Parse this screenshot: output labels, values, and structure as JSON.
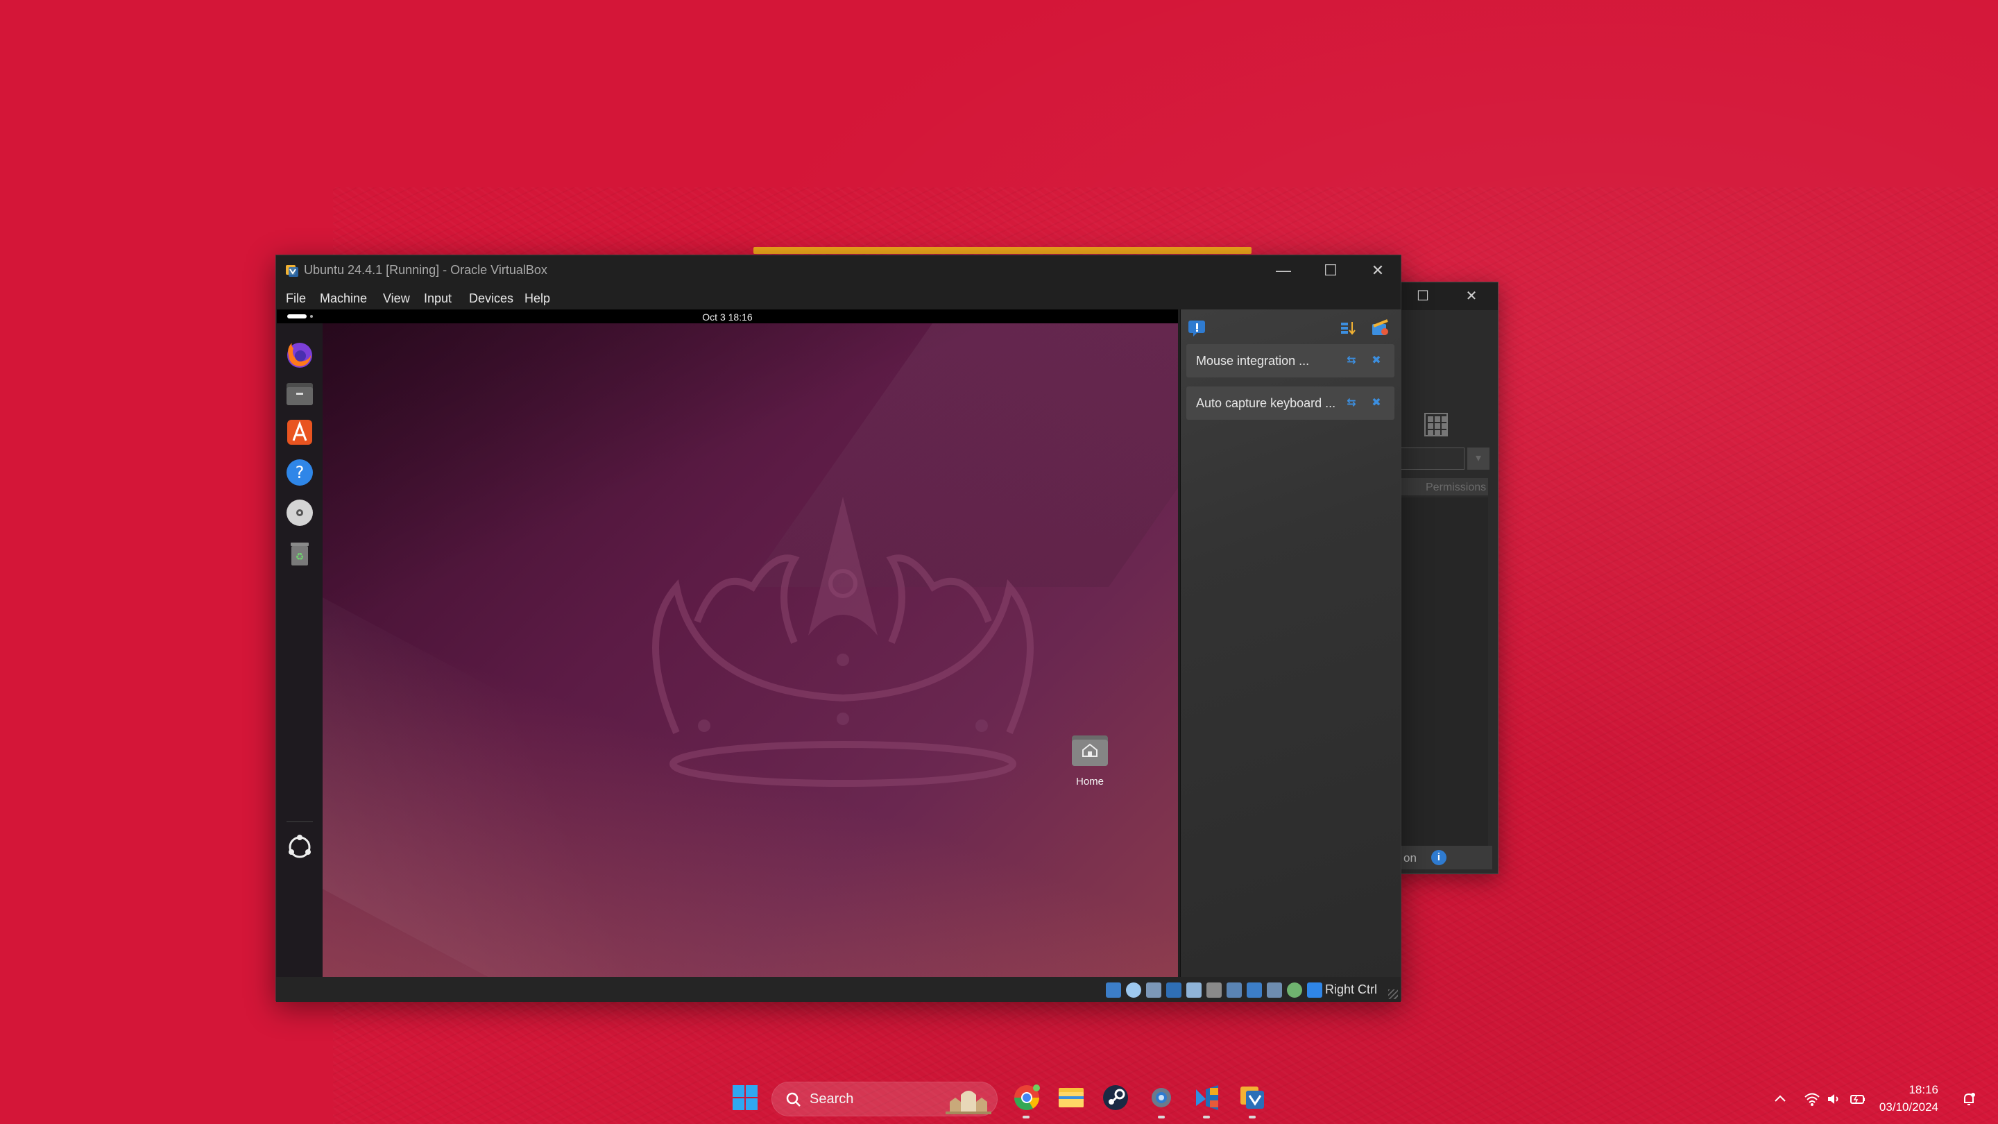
{
  "window": {
    "title": "Ubuntu 24.4.1 [Running] - Oracle VirtualBox",
    "minimize": "—",
    "maximize": "☐",
    "close": "✕"
  },
  "menubar": {
    "items": [
      "File",
      "Machine",
      "View",
      "Input",
      "Devices",
      "Help"
    ]
  },
  "guest": {
    "clock": "Oct 3  18:16",
    "dock": [
      {
        "icon": "firefox-icon"
      },
      {
        "icon": "files-icon"
      },
      {
        "icon": "app-center-icon"
      },
      {
        "icon": "help-icon"
      },
      {
        "icon": "disc-icon"
      },
      {
        "icon": "trash-icon"
      },
      {
        "icon": "show-apps-icon"
      }
    ],
    "desktop_icons": [
      {
        "label": "Home",
        "icon": "home-folder-icon"
      }
    ]
  },
  "notifications": {
    "items": [
      {
        "text": "Mouse integration ..."
      },
      {
        "text": "Auto capture keyboard ..."
      }
    ]
  },
  "statusbar": {
    "host_key": "Right Ctrl"
  },
  "back_window": {
    "column_header": "Permissions",
    "footer_text": "on",
    "info_icon": "i"
  },
  "taskbar": {
    "search_label": "Search",
    "apps": [
      "start-icon",
      "chrome-icon",
      "file-explorer-icon",
      "steam-icon",
      "settings-icon",
      "vscode-icon",
      "virtualbox-icon"
    ]
  },
  "tray": {
    "time": "18:16",
    "date": "03/10/2024"
  },
  "colors": {
    "desktop_bg": "#d41638",
    "ubuntu_purple": "#5c1b45",
    "accent_blue": "#3c8fe0"
  }
}
